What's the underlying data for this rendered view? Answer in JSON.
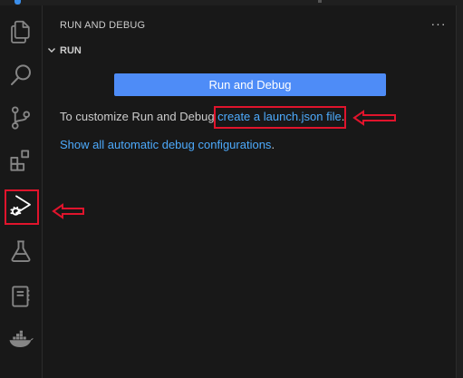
{
  "activity_bar": {
    "icons": [
      "explorer-icon",
      "search-icon",
      "source-control-icon",
      "extensions-icon",
      "run-debug-icon",
      "testing-icon",
      "notebook-icon",
      "docker-icon"
    ]
  },
  "sidebar": {
    "title": "RUN AND DEBUG",
    "more_actions": "···",
    "section": {
      "label": "RUN",
      "expanded": true
    },
    "run_button_label": "Run and Debug",
    "customize_prefix": "To customize Run and Debug ",
    "customize_link": "create a launch.json file",
    "customize_suffix": ".",
    "show_all_link": "Show all automatic debug configurations",
    "show_all_suffix": "."
  },
  "colors": {
    "background": "#181818",
    "button": "#4e8cf7",
    "link": "#4daafc",
    "annotation": "#e0142c"
  }
}
